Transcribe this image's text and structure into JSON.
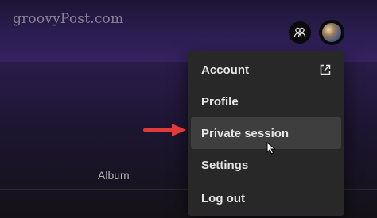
{
  "watermark": "groovyPost.com",
  "header": {
    "friend_activity_icon": "people-icon",
    "avatar_icon": "avatar-image"
  },
  "table": {
    "column_album": "Album"
  },
  "menu": {
    "items": [
      {
        "label": "Account",
        "icon": "external-link-icon"
      },
      {
        "label": "Profile"
      },
      {
        "label": "Private session"
      },
      {
        "label": "Settings"
      },
      {
        "label": "Log out"
      }
    ]
  },
  "annotation": {
    "arrow_color": "#e03a3a"
  },
  "colors": {
    "menu_bg": "#282828",
    "menu_hover": "#3e3e3e",
    "menu_text": "#e6e6e6",
    "header_purple": "#35235f"
  }
}
